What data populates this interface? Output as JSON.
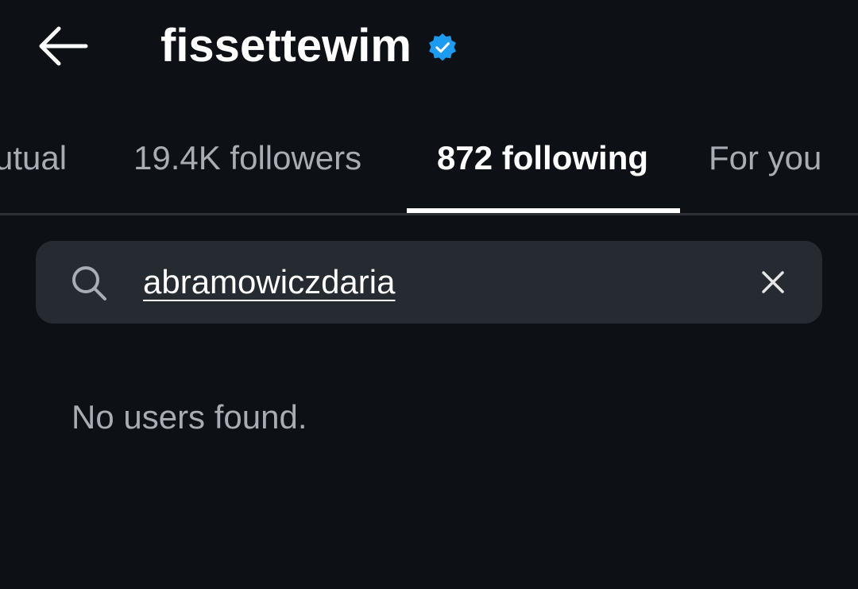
{
  "header": {
    "title": "fissettewim",
    "verified_badge": "verified-badge-icon",
    "back_icon": "arrow-left-icon"
  },
  "tabs": [
    {
      "label": "Mutual",
      "active": false
    },
    {
      "label": "19.4K followers",
      "active": false
    },
    {
      "label": "872 following",
      "active": true
    },
    {
      "label": "For you",
      "active": false
    }
  ],
  "search": {
    "value": "abramowiczdaria",
    "icon": "search-icon",
    "clear_icon": "close-icon"
  },
  "results": {
    "empty_message": "No users found."
  },
  "colors": {
    "background": "#0d1015",
    "accent": "#1d9bf0",
    "search_bg": "#262a31",
    "muted_text": "#a8acb3"
  }
}
